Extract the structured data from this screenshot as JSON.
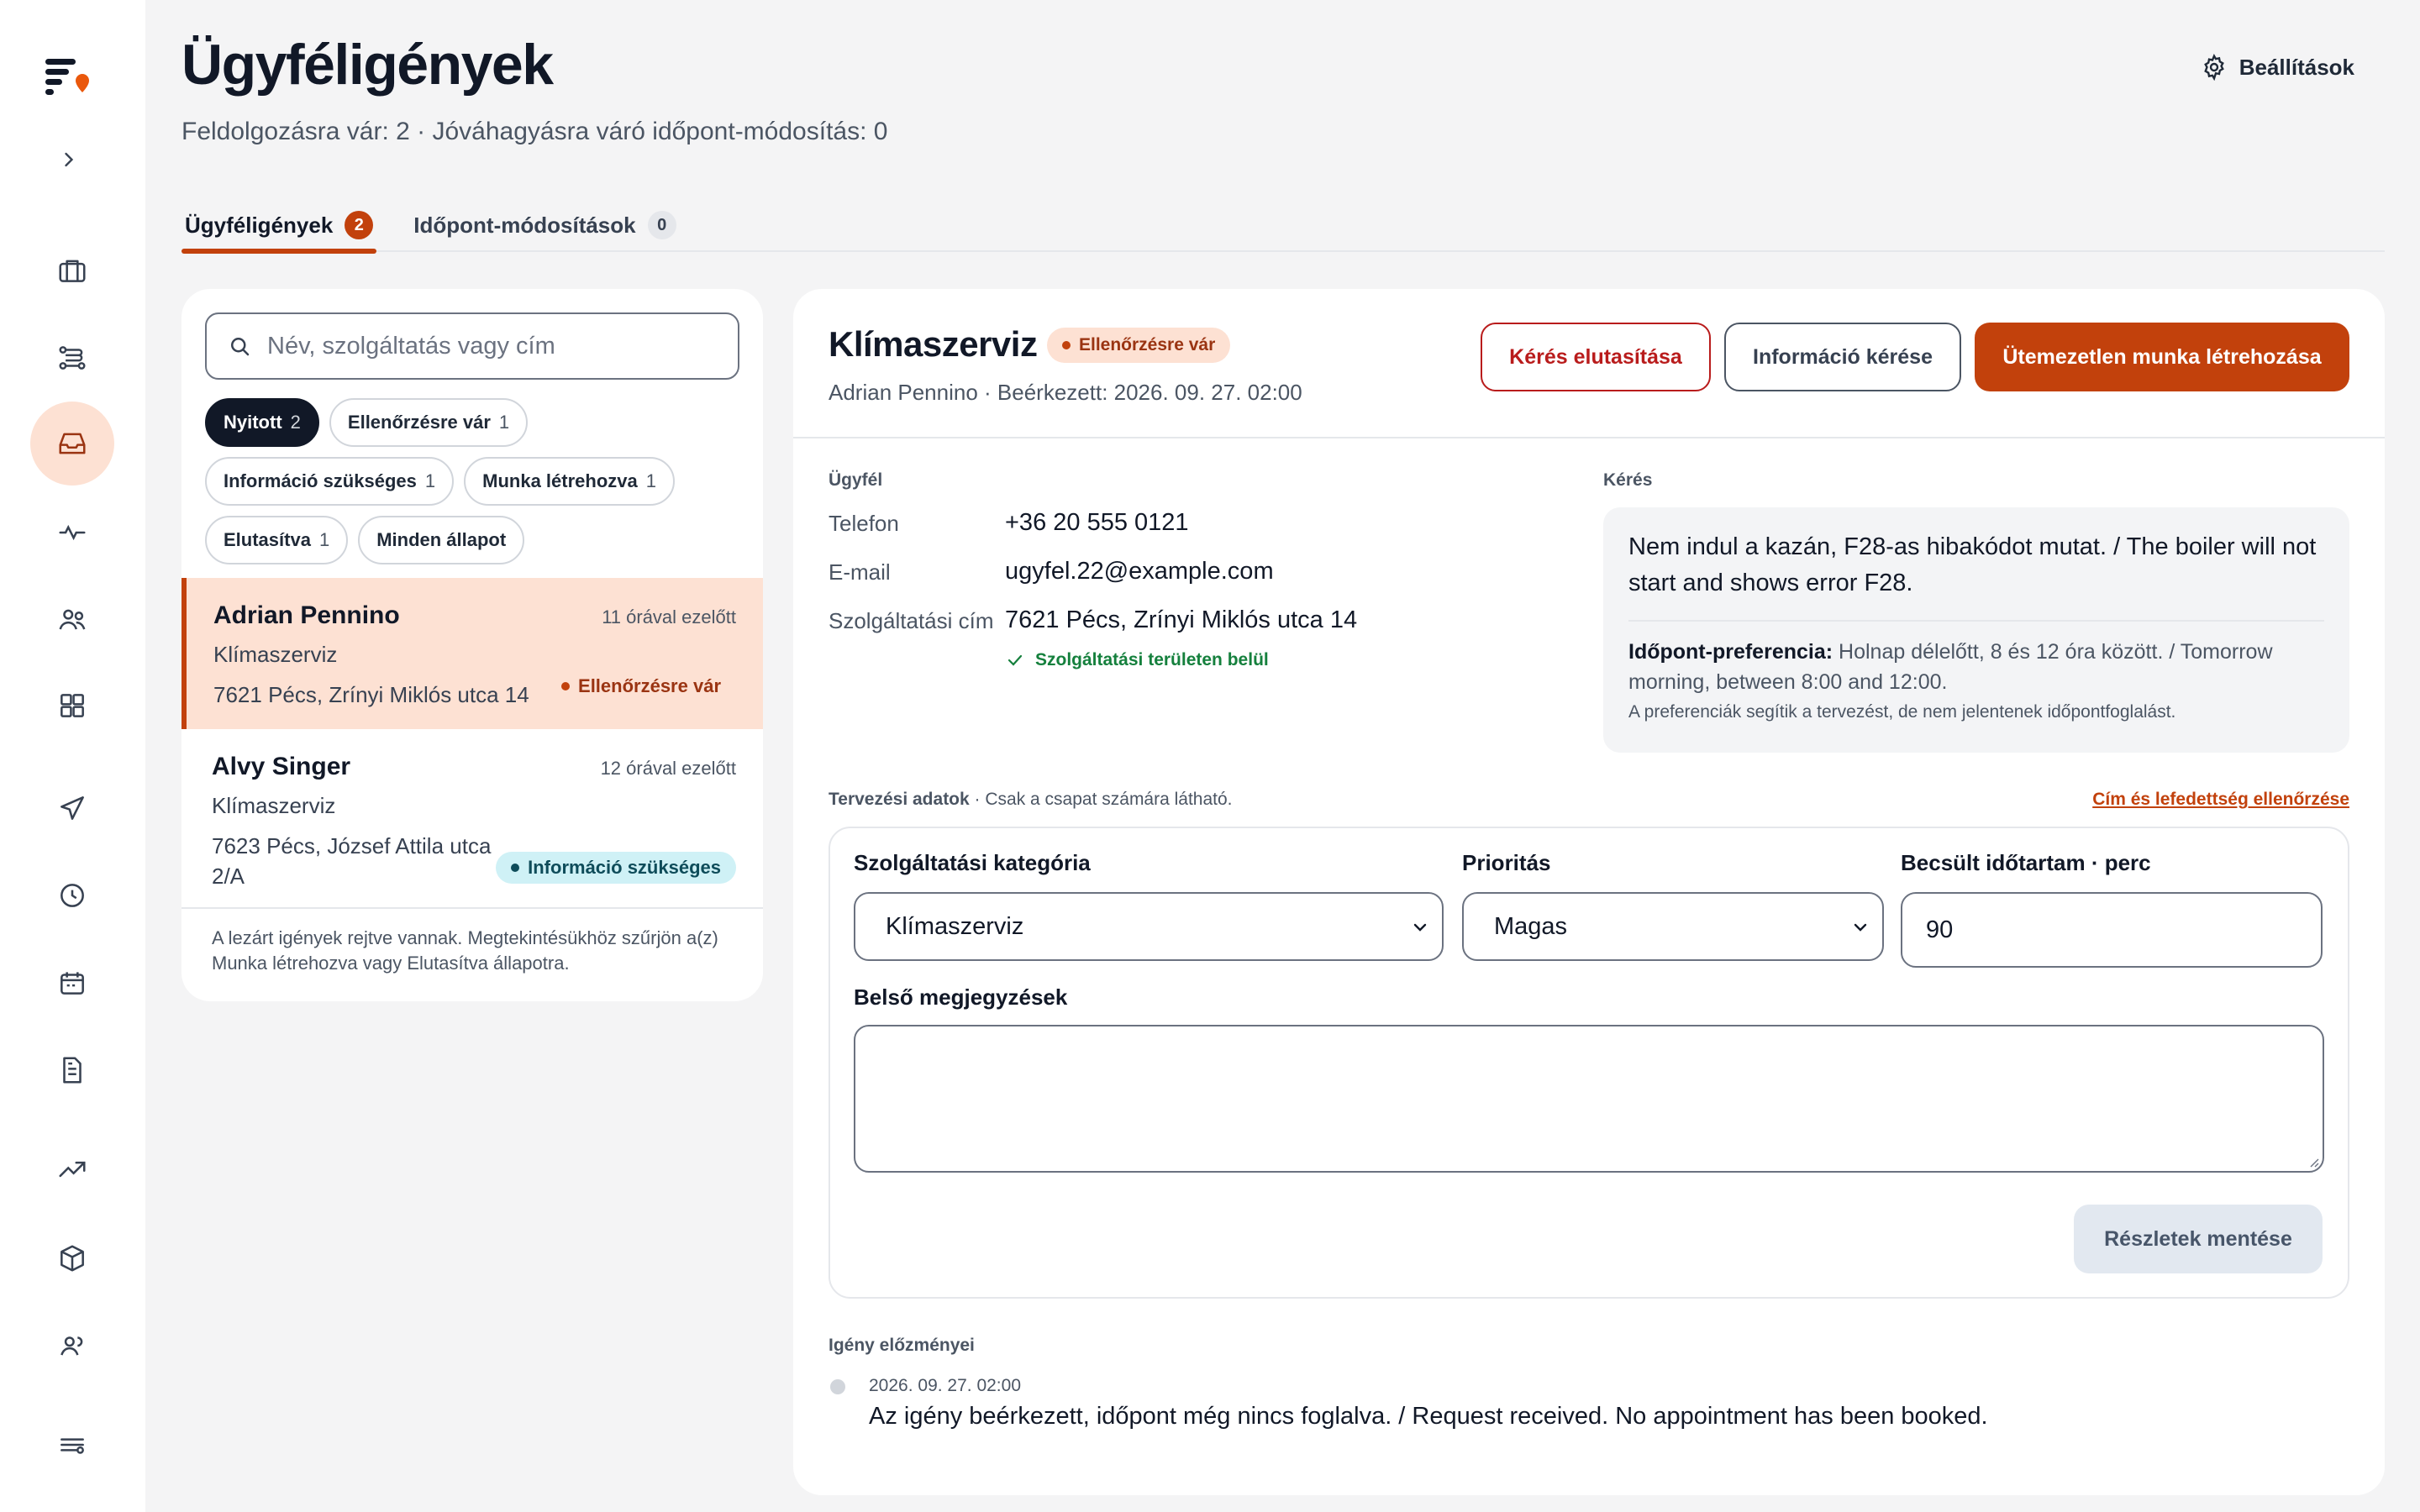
{
  "page": {
    "title": "Ügyféligények",
    "subtitle": "Feldolgozásra vár: 2 · Jóváhagyásra váró időpont-módosítás: 0",
    "settings_label": "Beállítások"
  },
  "sidebar": {
    "accent_color": "#c2410c",
    "items": [
      {
        "icon": "briefcase-icon"
      },
      {
        "icon": "workflow-icon"
      },
      {
        "icon": "inbox-icon",
        "active": true
      },
      {
        "icon": "activity-icon"
      },
      {
        "icon": "users-icon"
      },
      {
        "icon": "dashboard-icon"
      },
      {
        "icon": "megaphone-icon"
      },
      {
        "icon": "clock-icon"
      },
      {
        "icon": "calendar-icon"
      },
      {
        "icon": "document-icon"
      },
      {
        "icon": "trending-up-icon"
      },
      {
        "icon": "box-icon"
      },
      {
        "icon": "team-icon"
      },
      {
        "icon": "menu-settings-icon"
      }
    ]
  },
  "tabs": [
    {
      "label": "Ügyféligények",
      "count": "2",
      "active": true
    },
    {
      "label": "Időpont-módosítások",
      "count": "0",
      "active": false
    }
  ],
  "search": {
    "placeholder": "Név, szolgáltatás vagy cím"
  },
  "filters": [
    {
      "label": "Nyitott",
      "count": "2",
      "active": true
    },
    {
      "label": "Ellenőrzésre vár",
      "count": "1"
    },
    {
      "label": "Információ szükséges",
      "count": "1"
    },
    {
      "label": "Munka létrehozva",
      "count": "1"
    },
    {
      "label": "Elutasítva",
      "count": "1"
    },
    {
      "label": "Minden állapot",
      "count": ""
    }
  ],
  "requests": [
    {
      "name": "Adrian Pennino",
      "ago": "11 órával ezelőtt",
      "service": "Klímaszerviz",
      "address": "7621 Pécs, Zrínyi Miklós utca 14",
      "status": "Ellenőrzésre vár",
      "selected": true
    },
    {
      "name": "Alvy Singer",
      "ago": "12 órával ezelőtt",
      "service": "Klímaszerviz",
      "address": "7623 Pécs, József Attila utca 2/A",
      "status": "Információ szükséges"
    }
  ],
  "hidden_note": "A lezárt igények rejtve vannak. Megtekintésükhöz szűrjön a(z) Munka létrehozva vagy Elutasítva állapotra.",
  "detail": {
    "title": "Klímaszerviz",
    "status": "Ellenőrzésre vár",
    "meta": "Adrian Pennino · Beérkezett: 2026. 09. 27. 02:00",
    "buttons": {
      "reject": "Kérés elutasítása",
      "request_info": "Információ kérése",
      "create_job": "Ütemezetlen munka létrehozása"
    },
    "customer": {
      "section_label": "Ügyfél",
      "phone_label": "Telefon",
      "phone": "+36 20 555 0121",
      "email_label": "E-mail",
      "email": "ugyfel.22@example.com",
      "address_label": "Szolgáltatási cím",
      "address": "7621 Pécs, Zrínyi Miklós utca 14",
      "coverage": "Szolgáltatási területen belül"
    },
    "request": {
      "section_label": "Kérés",
      "text": "Nem indul a kazán, F28-as hibakódot mutat. / The boiler will not start and shows error F28.",
      "preference_label": "Időpont-preferencia:",
      "preference": "Holnap délelőtt, 8 és 12 óra között. / Tomorrow morning, between 8:00 and 12:00.",
      "preference_note": "A preferenciák segítik a tervezést, de nem jelentenek időpontfoglalást."
    },
    "planning": {
      "label": "Tervezési adatok",
      "label_note": " · Csak a csapat számára látható.",
      "coverage_link": "Cím és lefedettség ellenőrzése",
      "category_label": "Szolgáltatási kategória",
      "category_value": "Klímaszerviz",
      "priority_label": "Prioritás",
      "priority_value": "Magas",
      "duration_label": "Becsült időtartam · perc",
      "duration_value": "90",
      "notes_label": "Belső megjegyzések",
      "notes_value": "",
      "save_label": "Részletek mentése"
    },
    "history": {
      "label": "Igény előzményei",
      "entries": [
        {
          "time": "2026. 09. 27. 02:00",
          "text": "Az igény beérkezett, időpont még nincs foglalva. / Request received. No appointment has been booked."
        }
      ]
    }
  }
}
